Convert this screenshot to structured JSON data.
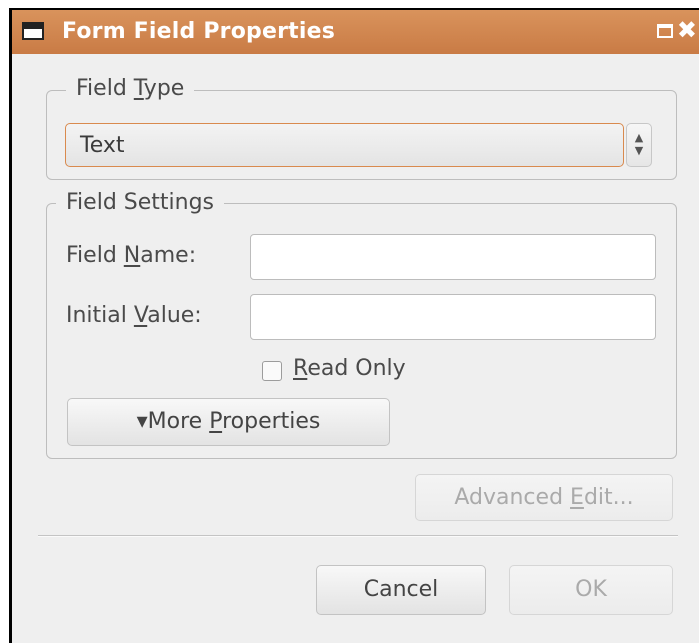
{
  "window": {
    "title": "Form Field Properties"
  },
  "field_type": {
    "legend_pre": "Field ",
    "legend_u": "T",
    "legend_post": "ype",
    "selected": "Text"
  },
  "field_settings": {
    "legend": "Field Settings",
    "name_label_pre": "Field ",
    "name_label_u": "N",
    "name_label_post": "ame:",
    "name_value": "",
    "initial_label_pre": "Initial ",
    "initial_label_u": "V",
    "initial_label_post": "alue:",
    "initial_value": "",
    "readonly_u": "R",
    "readonly_post": "ead Only",
    "more_prefix": "▾More ",
    "more_u": "P",
    "more_post": "roperties"
  },
  "advanced": {
    "pre": "Advanced ",
    "u": "E",
    "post": "dit..."
  },
  "actions": {
    "cancel": "Cancel",
    "ok": "OK"
  }
}
